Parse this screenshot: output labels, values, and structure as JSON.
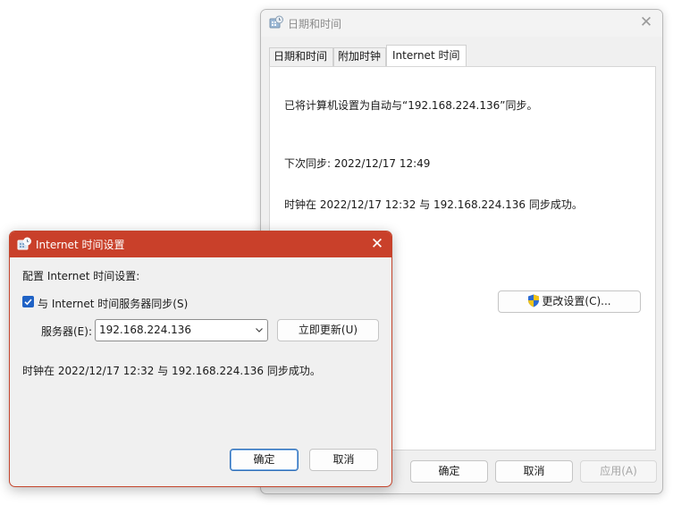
{
  "back_dialog": {
    "title": "日期和时间",
    "close_glyph": "✕",
    "tabs": [
      {
        "label": "日期和时间",
        "active": false
      },
      {
        "label": "附加时钟",
        "active": false
      },
      {
        "label": "Internet 时间",
        "active": true
      }
    ],
    "sync_config_text": "已将计算机设置为自动与“192.168.224.136”同步。",
    "next_sync_text": "下次同步: 2022/12/17 12:49",
    "last_sync_text": "时钟在 2022/12/17 12:32 与 192.168.224.136 同步成功。",
    "change_settings_label": "更改设置(C)...",
    "ok_label": "确定",
    "cancel_label": "取消",
    "apply_label": "应用(A)"
  },
  "front_dialog": {
    "title": "Internet 时间设置",
    "close_glyph": "✕",
    "heading": "配置 Internet 时间设置:",
    "sync_checkbox_label": "与 Internet 时间服务器同步(S)",
    "sync_checked": true,
    "server_label": "服务器(E):",
    "server_value": "192.168.224.136",
    "update_now_label": "立即更新(U)",
    "status_text": "时钟在 2022/12/17 12:32 与 192.168.224.136 同步成功。",
    "ok_label": "确定",
    "cancel_label": "取消"
  },
  "colors": {
    "front_titlebar": "#c9402a",
    "checkbox_accent": "#1f62c5",
    "primary_button_border": "#2f6fb8"
  },
  "icons": {
    "app": "datetime-control-panel-icon",
    "uac": "uac-shield-icon",
    "close": "close-icon",
    "dropdown": "chevron-down-icon"
  }
}
